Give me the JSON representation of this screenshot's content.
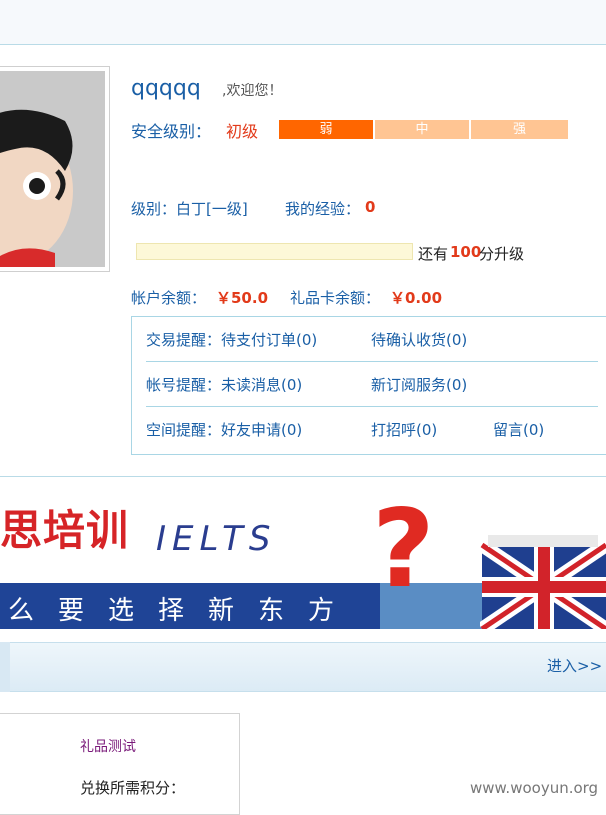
{
  "user": {
    "name": "qqqqq",
    "welcome": ",欢迎您！"
  },
  "security": {
    "label": "安全级别：",
    "value": "初级",
    "levels": [
      "弱",
      "中",
      "强"
    ],
    "active_color": "#ff6600",
    "inactive_color": "#ffc593"
  },
  "profile": {
    "level": "级别：白丁[一级]",
    "exp_label": "我的经验：",
    "exp_value": "0",
    "upgrade_prefix": "还有",
    "upgrade_points": "100",
    "upgrade_suffix": "分升级",
    "progress_fraction": 0.0,
    "balance_label": "帐户余额：",
    "balance_value": "￥50.0",
    "gift_balance_label": "礼品卡余额：",
    "gift_balance_value": "￥0.00"
  },
  "reminders": {
    "trade": {
      "label": "交易提醒：待支付订单(0)",
      "second": "待确认收货(0)"
    },
    "account": {
      "label": "帐号提醒：未读消息(0)",
      "second": "新订阅服务(0)"
    },
    "space": {
      "label": "空间提醒：好友申请(0)",
      "second": "打招呼(0)",
      "third": "留言(0)"
    }
  },
  "banner": {
    "title": "思培训",
    "ielts": "IELTS",
    "slogan": "么要选择新东方",
    "question": "?"
  },
  "enter_link": "进入>>",
  "gift_item": {
    "title": "礼品测试",
    "points_label": "兑换所需积分："
  },
  "watermark": "www.wooyun.org",
  "colors": {
    "link_blue": "#1a5fa6",
    "accent_red": "#e23a1a",
    "border_blue": "#a9d6e5"
  }
}
